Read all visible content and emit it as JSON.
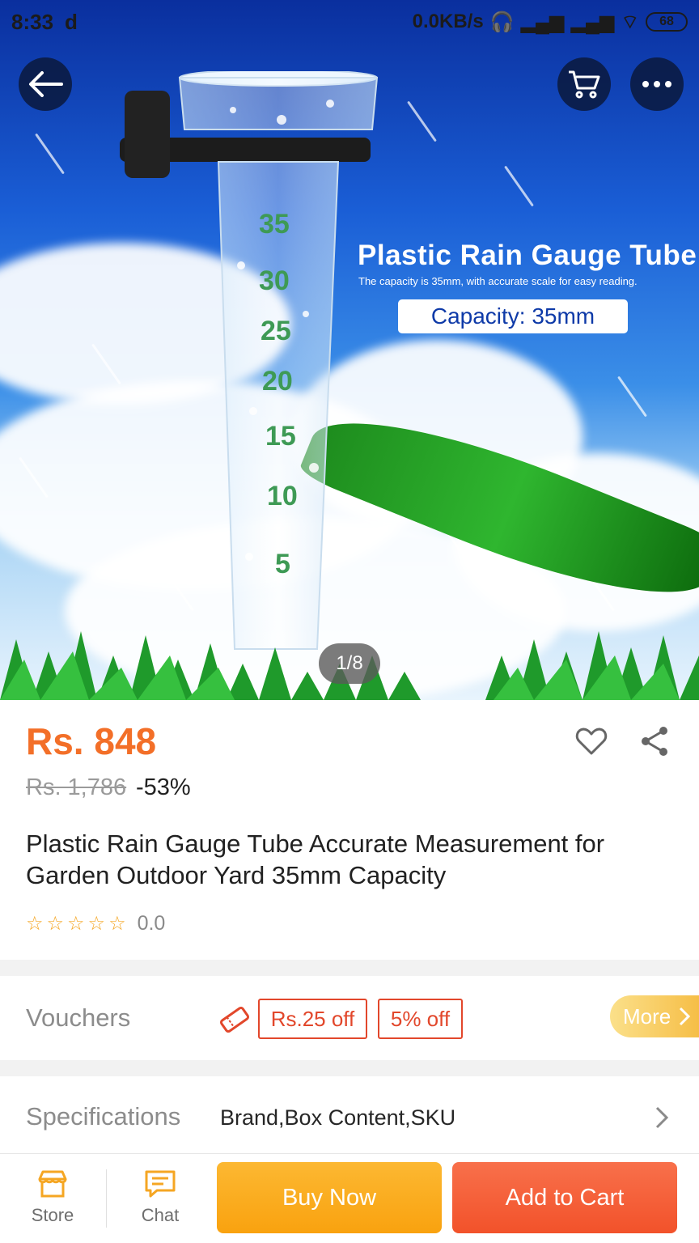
{
  "status_bar": {
    "time": "8:33",
    "carrier_icon": "d",
    "network_speed": "0.0KB/s",
    "battery": "68",
    "icons": [
      "headset-icon",
      "signal-icon",
      "signal-icon",
      "wifi-icon",
      "battery-icon"
    ]
  },
  "header": {
    "back_icon": "arrow-left-icon",
    "cart_icon": "cart-icon",
    "more_icon": "more-dots-icon"
  },
  "gallery": {
    "promo_title": "Plastic Rain Gauge Tube",
    "promo_subtitle": "The capacity is 35mm, with accurate scale for easy reading.",
    "promo_badge": "Capacity: 35mm",
    "counter": "1/8",
    "tube_markings": [
      "35",
      "30",
      "25",
      "20",
      "15",
      "10",
      "5"
    ]
  },
  "product": {
    "price": "Rs. 848",
    "original_price": "Rs. 1,786",
    "discount": "-53%",
    "title": "Plastic Rain Gauge Tube Accurate Measurement for Garden Outdoor Yard 35mm Capacity",
    "rating_value": "0.0",
    "stars": 0
  },
  "vouchers": {
    "label": "Vouchers",
    "items": [
      "Rs.25 off",
      "5% off"
    ],
    "more_label": "More"
  },
  "specifications": {
    "label": "Specifications",
    "value": "Brand,Box Content,SKU"
  },
  "bottom_bar": {
    "store_label": "Store",
    "chat_label": "Chat",
    "buy_now_label": "Buy Now",
    "add_to_cart_label": "Add to Cart"
  },
  "colors": {
    "price": "#f36f28",
    "buy_now": "#f9a20f",
    "add_to_cart": "#f2522a",
    "voucher": "#e2472b"
  }
}
